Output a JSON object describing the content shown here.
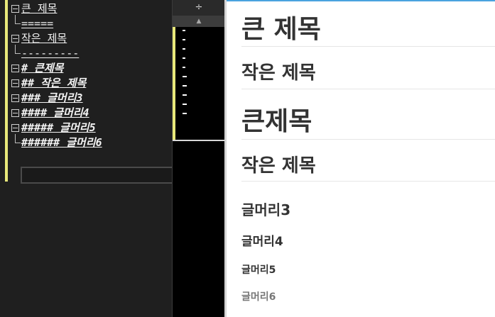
{
  "outline": {
    "rows": [
      {
        "label": "큰 제목",
        "kind": "parent"
      },
      {
        "label": "=====",
        "kind": "child"
      },
      {
        "label": "작은 제목",
        "kind": "parent"
      },
      {
        "label": "---------",
        "kind": "child"
      },
      {
        "label": "# 큰제목",
        "kind": "h"
      },
      {
        "label": "## 작은 제목",
        "kind": "h"
      },
      {
        "label": "### 글머리3",
        "kind": "h"
      },
      {
        "label": "#### 글머리4",
        "kind": "h"
      },
      {
        "label": "##### 글머리5",
        "kind": "h"
      },
      {
        "label": "###### 글머리6",
        "kind": "hleaf"
      }
    ],
    "search_value": ""
  },
  "minimap": {
    "header_icon": "÷",
    "up_arrow": "▲"
  },
  "preview": {
    "h1_setext": "큰 제목",
    "h2_setext": "작은 제목",
    "h1": "큰제목",
    "h2": "작은 제목",
    "h3": "글머리3",
    "h4": "글머리4",
    "h5": "글머리5",
    "h6": "글머리6"
  },
  "colors": {
    "accent_yellow": "#e8e87a",
    "preview_top_bar": "#4aa3df",
    "editor_bg": "#1f1f1f"
  }
}
